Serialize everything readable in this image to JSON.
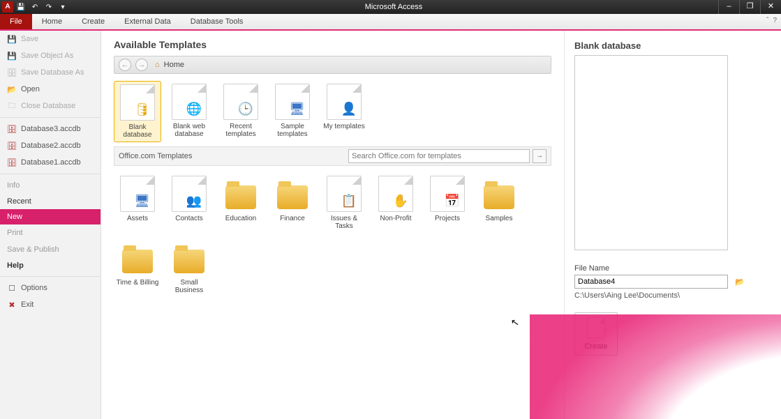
{
  "titlebar": {
    "title": "Microsoft Access",
    "app_letter": "A"
  },
  "winbtns": {
    "min": "–",
    "restore": "❐",
    "close": "✕"
  },
  "ribbon": {
    "file": "File",
    "home": "Home",
    "create": "Create",
    "external": "External Data",
    "tools": "Database Tools",
    "help_up": "ˆ",
    "help_q": "?"
  },
  "rail": {
    "save": "Save",
    "save_object_as": "Save Object As",
    "save_db_as": "Save Database As",
    "open": "Open",
    "close_db": "Close Database",
    "recent_files": [
      "Database3.accdb",
      "Database2.accdb",
      "Database1.accdb"
    ],
    "info": "Info",
    "recent": "Recent",
    "new": "New",
    "print": "Print",
    "save_publish": "Save & Publish",
    "help": "Help",
    "options": "Options",
    "exit": "Exit"
  },
  "main": {
    "heading": "Available Templates",
    "nav_back": "←",
    "nav_fwd": "→",
    "nav_home_icon": "⌂",
    "breadcrumb": "Home",
    "local_templates": [
      {
        "label": "Blank database",
        "kind": "page",
        "overlay": "🛢",
        "overlay_color": "#e8a400",
        "selected": true
      },
      {
        "label": "Blank web database",
        "kind": "page",
        "overlay": "🌐",
        "overlay_color": "#2a7d2a"
      },
      {
        "label": "Recent templates",
        "kind": "page",
        "overlay": "🕒",
        "overlay_color": "#888"
      },
      {
        "label": "Sample templates",
        "kind": "page",
        "overlay": "🖥",
        "overlay_color": "#3b76c4"
      },
      {
        "label": "My templates",
        "kind": "page",
        "overlay": "👤",
        "overlay_color": "#d0593a"
      }
    ],
    "office_section": "Office.com Templates",
    "search_placeholder": "Search Office.com for templates",
    "go": "→",
    "office_templates": [
      {
        "label": "Assets",
        "kind": "page",
        "overlay": "🖥",
        "overlay_color": "#3b76c4"
      },
      {
        "label": "Contacts",
        "kind": "page",
        "overlay": "👥",
        "overlay_color": "#3b76c4"
      },
      {
        "label": "Education",
        "kind": "folder"
      },
      {
        "label": "Finance",
        "kind": "folder"
      },
      {
        "label": "Issues & Tasks",
        "kind": "page",
        "overlay": "📋",
        "overlay_color": "#b03030"
      },
      {
        "label": "Non-Profit",
        "kind": "page",
        "overlay": "✋",
        "overlay_color": "#888"
      },
      {
        "label": "Projects",
        "kind": "page",
        "overlay": "📅",
        "overlay_color": "#c06050"
      },
      {
        "label": "Samples",
        "kind": "folder"
      },
      {
        "label": "Time & Billing",
        "kind": "folder"
      },
      {
        "label": "Small Business",
        "kind": "folder"
      }
    ]
  },
  "right": {
    "heading": "Blank database",
    "filename_label": "File Name",
    "filename_value": "Database4",
    "path": "C:\\Users\\Aing Lee\\Documents\\",
    "create": "Create"
  }
}
